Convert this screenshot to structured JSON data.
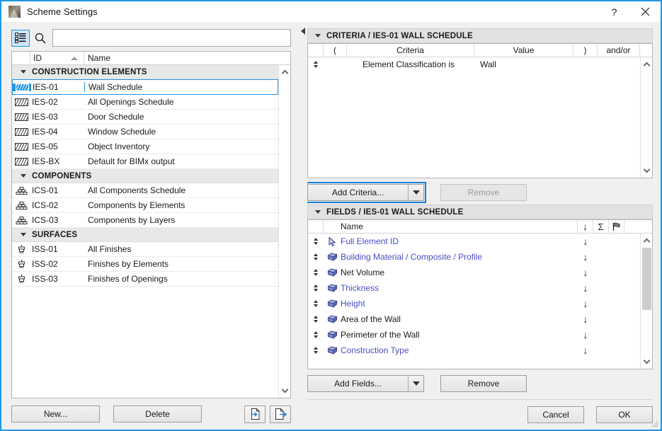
{
  "window": {
    "title": "Scheme Settings",
    "app_icon": "archicad-icon",
    "help_label": "?",
    "close_label": "×"
  },
  "left": {
    "tree_toggle_icon": "tree-view-icon",
    "search_icon": "search-icon",
    "search": {
      "value": "",
      "placeholder": ""
    },
    "columns": {
      "id": "ID",
      "name": "Name"
    },
    "groups": [
      {
        "label": "CONSTRUCTION ELEMENTS",
        "icon": "wall-hatch-icon",
        "items": [
          {
            "id": "IES-01",
            "name": "Wall Schedule",
            "selected": true
          },
          {
            "id": "IES-02",
            "name": "All Openings Schedule",
            "selected": false
          },
          {
            "id": "IES-03",
            "name": "Door Schedule",
            "selected": false
          },
          {
            "id": "IES-04",
            "name": "Window Schedule",
            "selected": false
          },
          {
            "id": "IES-05",
            "name": "Object Inventory",
            "selected": false
          },
          {
            "id": "IES-BX",
            "name": "Default for BIMx output",
            "selected": false
          }
        ]
      },
      {
        "label": "COMPONENTS",
        "icon": "brick-stack-icon",
        "items": [
          {
            "id": "ICS-01",
            "name": "All Components Schedule",
            "selected": false
          },
          {
            "id": "ICS-02",
            "name": "Components by Elements",
            "selected": false
          },
          {
            "id": "ICS-03",
            "name": "Components by Layers",
            "selected": false
          }
        ]
      },
      {
        "label": "SURFACES",
        "icon": "paintbrush-icon",
        "items": [
          {
            "id": "ISS-01",
            "name": "All Finishes",
            "selected": false
          },
          {
            "id": "ISS-02",
            "name": "Finishes by Elements",
            "selected": false
          },
          {
            "id": "ISS-03",
            "name": "Finishes of Openings",
            "selected": false
          }
        ]
      }
    ],
    "footer": {
      "new_label": "New...",
      "delete_label": "Delete",
      "import_icon": "import-scheme-icon",
      "export_icon": "export-scheme-icon"
    }
  },
  "criteria": {
    "header": "CRITERIA / IES-01 WALL SCHEDULE",
    "columns": {
      "open_paren": "(",
      "criteria": "Criteria",
      "value": "Value",
      "close_paren": ")",
      "andor": "and/or"
    },
    "rows": [
      {
        "open_paren": "",
        "criteria": "Element Classification is",
        "value": "Wall",
        "close_paren": "",
        "andor": ""
      }
    ],
    "add_label": "Add Criteria...",
    "add_focused": true,
    "remove_label": "Remove",
    "remove_disabled": true
  },
  "fields": {
    "header": "FIELDS / IES-01 WALL SCHEDULE",
    "columns": {
      "name": "Name",
      "sort_icon": "sort-descending-icon",
      "sum_icon": "sigma-sum-icon",
      "flag_icon": "flag-icon"
    },
    "rows": [
      {
        "name": "Full Element ID",
        "icon": "pointer-arrow-icon",
        "link": true,
        "sort": "↓"
      },
      {
        "name": "Building Material / Composite / Profile",
        "icon": "volume-box-icon",
        "link": true,
        "sort": "↓"
      },
      {
        "name": "Net Volume",
        "icon": "volume-box-icon",
        "link": false,
        "sort": "↓"
      },
      {
        "name": "Thickness",
        "icon": "volume-box-icon",
        "link": true,
        "sort": "↓"
      },
      {
        "name": "Height",
        "icon": "volume-box-icon",
        "link": true,
        "sort": "↓"
      },
      {
        "name": "Area of the Wall",
        "icon": "volume-box-icon",
        "link": false,
        "sort": "↓"
      },
      {
        "name": "Perimeter of the Wall",
        "icon": "volume-box-icon",
        "link": false,
        "sort": "↓"
      },
      {
        "name": "Construction Type",
        "icon": "volume-box-icon",
        "link": true,
        "sort": "↓"
      }
    ],
    "add_label": "Add Fields...",
    "remove_label": "Remove"
  },
  "dialog": {
    "cancel_label": "Cancel",
    "ok_label": "OK"
  },
  "colors": {
    "accent": "#2196e8",
    "link": "#4b4bc8",
    "panel": "#f0f0f0",
    "header_bg": "#e2e2e2"
  }
}
